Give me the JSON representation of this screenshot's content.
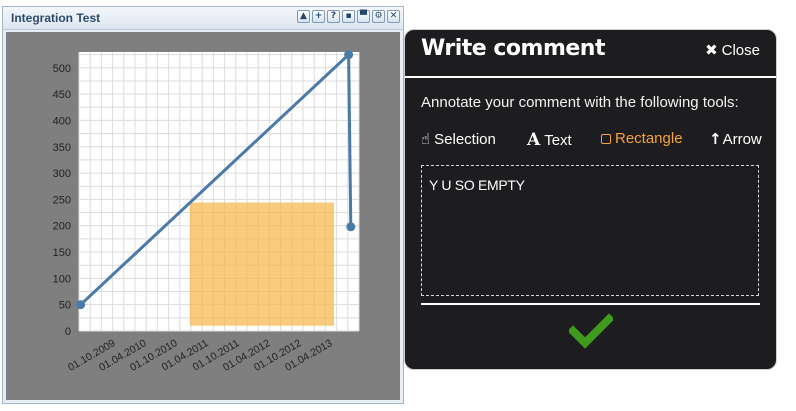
{
  "window": {
    "title": "Integration Test",
    "tool_buttons": [
      {
        "icon": "arrow-up-icon",
        "glyph": "▲"
      },
      {
        "icon": "plus-icon",
        "glyph": "+"
      },
      {
        "icon": "help-icon",
        "glyph": "?"
      },
      {
        "icon": "comment-icon",
        "glyph": "▪"
      },
      {
        "icon": "save-icon",
        "glyph": "▀"
      },
      {
        "icon": "settings-icon",
        "glyph": "⚙"
      },
      {
        "icon": "close-icon",
        "glyph": "✕"
      }
    ]
  },
  "chart_data": {
    "type": "line",
    "x_tick_labels": [
      "01.10.2009",
      "01.04.2010",
      "01.10.2010",
      "01.04.2011",
      "01.10.2011",
      "01.04.2012",
      "01.10.2012",
      "01.04.2013"
    ],
    "y_ticks": [
      0,
      50,
      100,
      150,
      200,
      250,
      300,
      350,
      400,
      450,
      500
    ],
    "ylim": [
      0,
      530
    ],
    "xlim": [
      "2009-07-01",
      "2013-09-15"
    ],
    "grid": true,
    "series": [
      {
        "color": "#4a7aa8",
        "points": [
          {
            "x": "2009-07-10",
            "y": 50
          },
          {
            "x": "2013-07-20",
            "y": 525
          },
          {
            "x": "2013-08-01",
            "y": 198
          }
        ]
      }
    ],
    "annotation_rectangle": {
      "x_start": "2011-03-01",
      "x_end": "2013-05-01",
      "y_low": 10,
      "y_high": 244,
      "color": "#f5b94a"
    }
  },
  "comment_panel": {
    "title": "Write comment",
    "close_label": "Close",
    "instruction": "Annotate your comment with the following tools:",
    "tools": [
      {
        "label": "Selection",
        "icon": "pointer-hand-icon",
        "glyph": "☝"
      },
      {
        "label": "Text",
        "icon": "text-icon",
        "glyph": "A"
      },
      {
        "label": "Rectangle",
        "icon": "rectangle-icon",
        "glyph": ""
      },
      {
        "label": "Arrow",
        "icon": "arrow-icon",
        "glyph": "↑"
      }
    ],
    "active_tool": "Rectangle",
    "comment_text": "Y U SO EMPTY",
    "accent_color": "#f5a33a",
    "confirm_icon": "checkmark-icon",
    "confirm_color": "#3f9a1e"
  }
}
